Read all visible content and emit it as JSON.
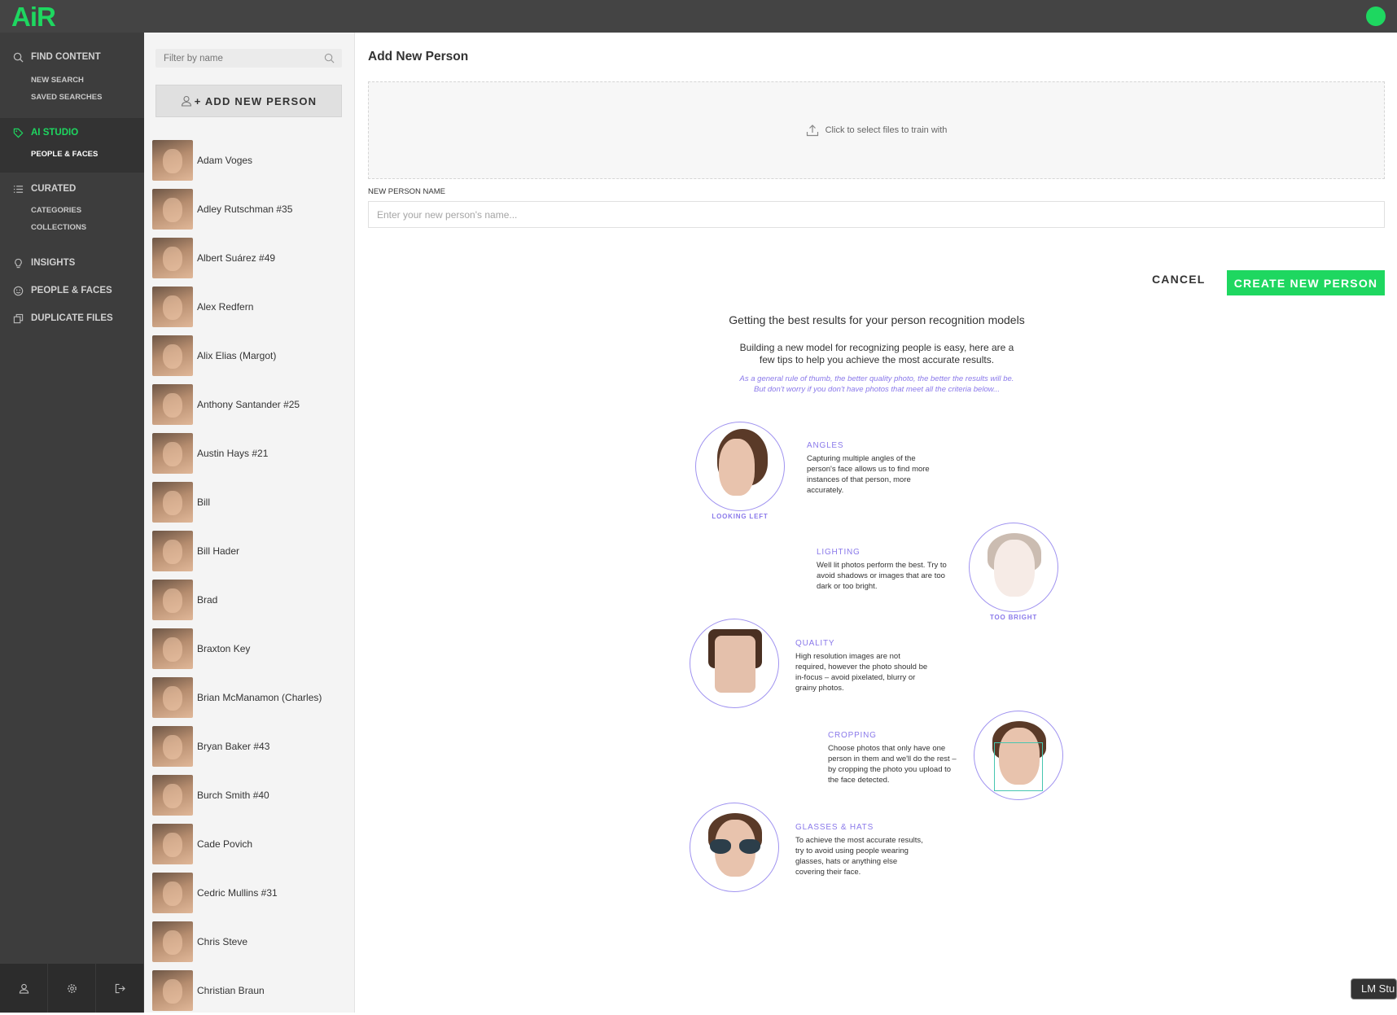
{
  "app": {
    "logo_text": "AiR",
    "logo_tm": "™",
    "brand_color": "#1ed760"
  },
  "sidebar": {
    "find_content": {
      "label": "FIND CONTENT",
      "subitems": [
        "NEW SEARCH",
        "SAVED SEARCHES"
      ]
    },
    "ai_studio": {
      "label": "AI STUDIO",
      "subitems": [
        "PEOPLE & FACES"
      ]
    },
    "curated": {
      "label": "CURATED",
      "subitems": [
        "CATEGORIES",
        "COLLECTIONS"
      ]
    },
    "insights": {
      "label": "INSIGHTS"
    },
    "people_faces": {
      "label": "PEOPLE & FACES"
    },
    "duplicate_files": {
      "label": "DUPLICATE FILES"
    }
  },
  "people_panel": {
    "filter_placeholder": "Filter by name",
    "add_button_label": "+ ADD NEW PERSON",
    "people": [
      "Adam Voges",
      "Adley Rutschman #35",
      "Albert Suárez #49",
      "Alex Redfern",
      "Alix Elias (Margot)",
      "Anthony Santander #25",
      "Austin Hays #21",
      "Bill",
      "Bill Hader",
      "Brad",
      "Braxton Key",
      "Brian McManamon (Charles)",
      "Bryan Baker #43",
      "Burch Smith #40",
      "Cade Povich",
      "Cedric Mullins #31",
      "Chris Steve",
      "Christian Braun"
    ]
  },
  "main": {
    "title": "Add New Person",
    "upload_text": "Click to select files to train with",
    "name_label": "NEW PERSON NAME",
    "name_placeholder": "Enter your new person's name...",
    "cancel_label": "CANCEL",
    "create_label": "CREATE NEW PERSON"
  },
  "tips": {
    "title": "Getting the best results for your person recognition models",
    "intro": "Building a new model for recognizing people is easy, here are a few tips to help you achieve the most accurate results.",
    "note": "As a general rule of thumb, the better quality photo, the better the results will be. But don't worry if you don't have photos that meet all the criteria below...",
    "items": [
      {
        "heading": "ANGLES",
        "body": "Capturing multiple angles of the person's face allows us to find more instances of that person, more accurately.",
        "caption": "LOOKING LEFT"
      },
      {
        "heading": "LIGHTING",
        "body": "Well lit photos perform the best. Try to avoid shadows or images that are too dark or too bright.",
        "caption": "TOO BRIGHT"
      },
      {
        "heading": "QUALITY",
        "body": "High resolution images are not required, however the photo should be in-focus – avoid pixelated, blurry or grainy photos.",
        "caption": ""
      },
      {
        "heading": "CROPPING",
        "body": "Choose photos that only have one person in them and we'll do the rest – by cropping the photo you upload to the face detected.",
        "caption": ""
      },
      {
        "heading": "GLASSES & HATS",
        "body": "To achieve the most accurate results, try to avoid using people wearing glasses, hats or anything else covering their face.",
        "caption": ""
      }
    ],
    "accent_color": "#8a79ea"
  },
  "overlay": {
    "badge_text": "LM Stu"
  }
}
